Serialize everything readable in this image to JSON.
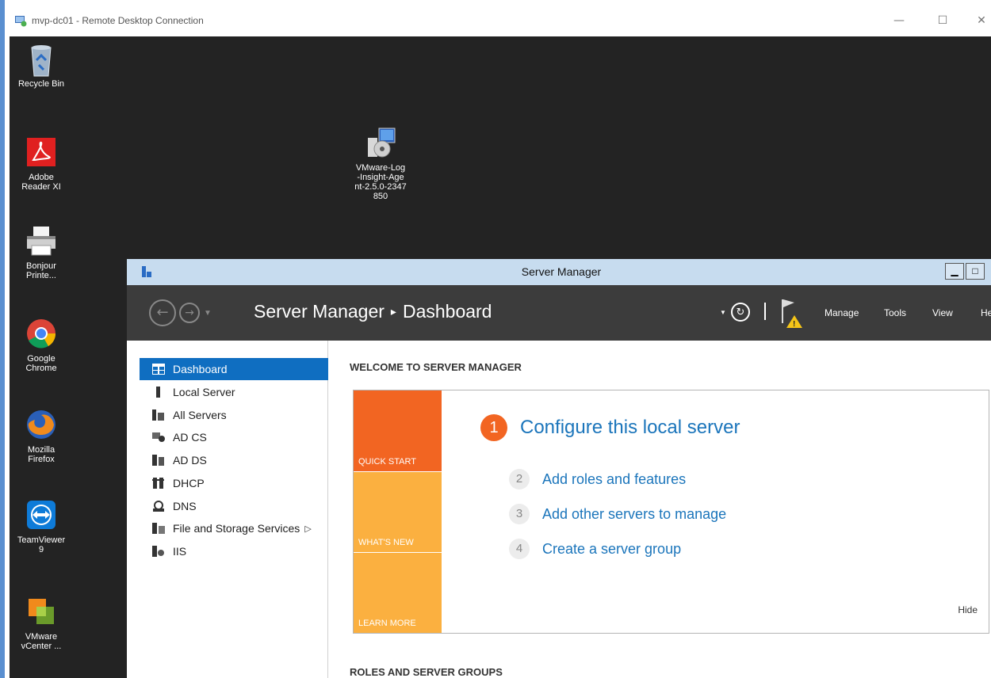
{
  "rdc_window": {
    "title": "mvp-dc01 - Remote Desktop Connection",
    "controls": {
      "minimize": "—",
      "maximize": "☐",
      "close": "✕"
    }
  },
  "desktop_icons": [
    {
      "label": "Recycle Bin",
      "icon": "recycle-bin-icon"
    },
    {
      "label": "Adobe\nReader XI",
      "icon": "adobe-reader-icon"
    },
    {
      "label": "Bonjour\nPrinte...",
      "icon": "printer-icon"
    },
    {
      "label": "Google\nChrome",
      "icon": "chrome-icon"
    },
    {
      "label": "Mozilla\nFirefox",
      "icon": "firefox-icon"
    },
    {
      "label": "TeamViewer\n9",
      "icon": "teamviewer-icon"
    },
    {
      "label": "VMware\nvCenter ...",
      "icon": "vmware-vcenter-icon"
    },
    {
      "label": "VMware-Log\n-Insight-Age\nnt-2.5.0-2347\n850",
      "icon": "installer-icon"
    }
  ],
  "server_manager": {
    "title": "Server Manager",
    "controls": {
      "minimize": "▁",
      "maximize": "□"
    },
    "header": {
      "app": "Server Manager",
      "separator": "▸",
      "page": "Dashboard",
      "menus": [
        "Manage",
        "Tools",
        "View",
        "Help"
      ]
    },
    "sidebar": [
      {
        "label": "Dashboard",
        "icon": "dashboard-icon",
        "active": true
      },
      {
        "label": "Local Server",
        "icon": "local-server-icon",
        "active": false
      },
      {
        "label": "All Servers",
        "icon": "all-servers-icon",
        "active": false
      },
      {
        "label": "AD CS",
        "icon": "ad-cs-icon",
        "active": false
      },
      {
        "label": "AD DS",
        "icon": "ad-ds-icon",
        "active": false
      },
      {
        "label": "DHCP",
        "icon": "dhcp-icon",
        "active": false
      },
      {
        "label": "DNS",
        "icon": "dns-icon",
        "active": false
      },
      {
        "label": "File and Storage Services",
        "icon": "file-storage-icon",
        "active": false,
        "has_submenu": true,
        "submenu_glyph": "▷"
      },
      {
        "label": "IIS",
        "icon": "iis-icon",
        "active": false
      }
    ],
    "main": {
      "welcome_title": "WELCOME TO SERVER MANAGER",
      "tiles": [
        "QUICK START",
        "WHAT'S NEW",
        "LEARN MORE"
      ],
      "steps": [
        {
          "num": "1",
          "text": "Configure this local server"
        },
        {
          "num": "2",
          "text": "Add roles and features"
        },
        {
          "num": "3",
          "text": "Add other servers to manage"
        },
        {
          "num": "4",
          "text": "Create a server group"
        }
      ],
      "hide_label": "Hide",
      "roles_title": "ROLES AND SERVER GROUPS"
    },
    "colors": {
      "accent_blue": "#0f6ec1",
      "quick_start": "#f26522",
      "tile_amber": "#fbb040",
      "link": "#1b75bb",
      "header_bg": "#3c3c3c"
    }
  }
}
